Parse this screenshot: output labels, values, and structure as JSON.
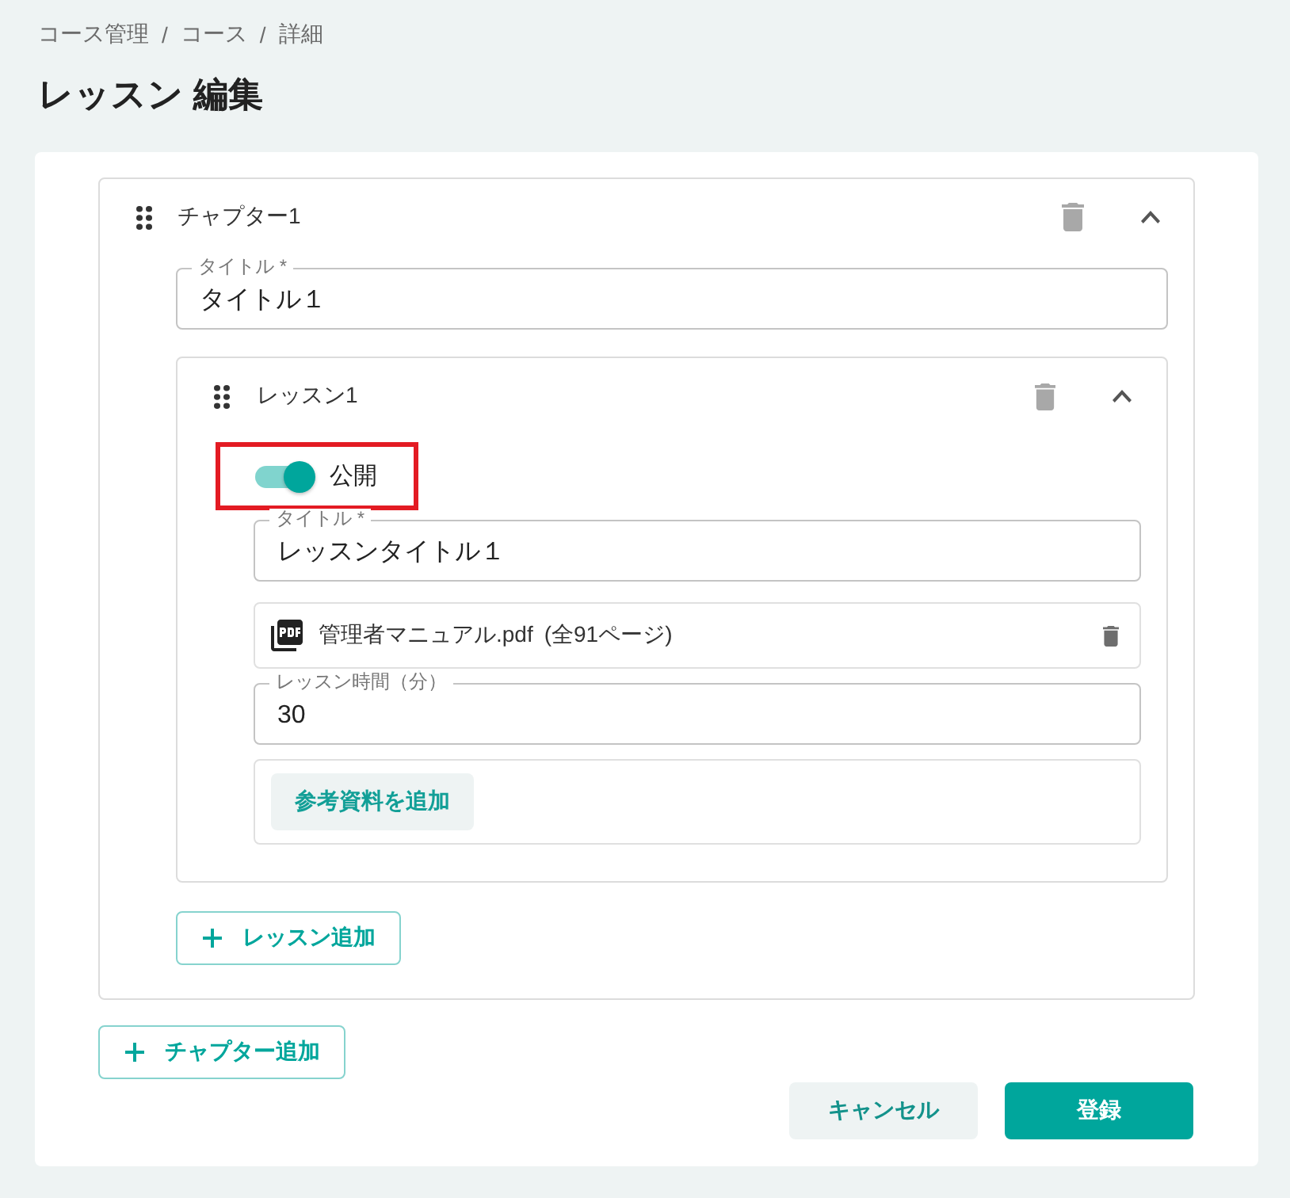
{
  "breadcrumb": [
    {
      "kind": "item",
      "text": "コース管理"
    },
    {
      "kind": "separator",
      "text": "/"
    },
    {
      "kind": "item",
      "text": "コース"
    },
    {
      "kind": "separator",
      "text": "/"
    },
    {
      "kind": "item",
      "text": "詳細"
    }
  ],
  "title": "レッスン 編集",
  "chapters": [
    {
      "label": "チャプター1",
      "expanded": true,
      "title_field": {
        "label": "タイトル *",
        "value": "タイトル１"
      },
      "lessons": [
        {
          "label": "レッスン1",
          "expanded": true,
          "published": {
            "label": "公開",
            "on": true,
            "highlighted": true
          },
          "title_field": {
            "label": "タイトル *",
            "value": "レッスンタイトル１"
          },
          "materials": [
            {
              "file_name": "管理者マニュアル.pdf",
              "pages": "(全91ページ)"
            }
          ],
          "duration_field": {
            "label": "レッスン時間（分）",
            "value": "30"
          },
          "add_material_button": "参考資料を追加"
        }
      ],
      "add_lesson_button": "レッスン追加"
    }
  ],
  "add_chapter_button": "チャプター追加",
  "actions": [
    {
      "kind": "secondary",
      "label": "キャンセル"
    },
    {
      "kind": "primary",
      "label": "登録"
    }
  ]
}
